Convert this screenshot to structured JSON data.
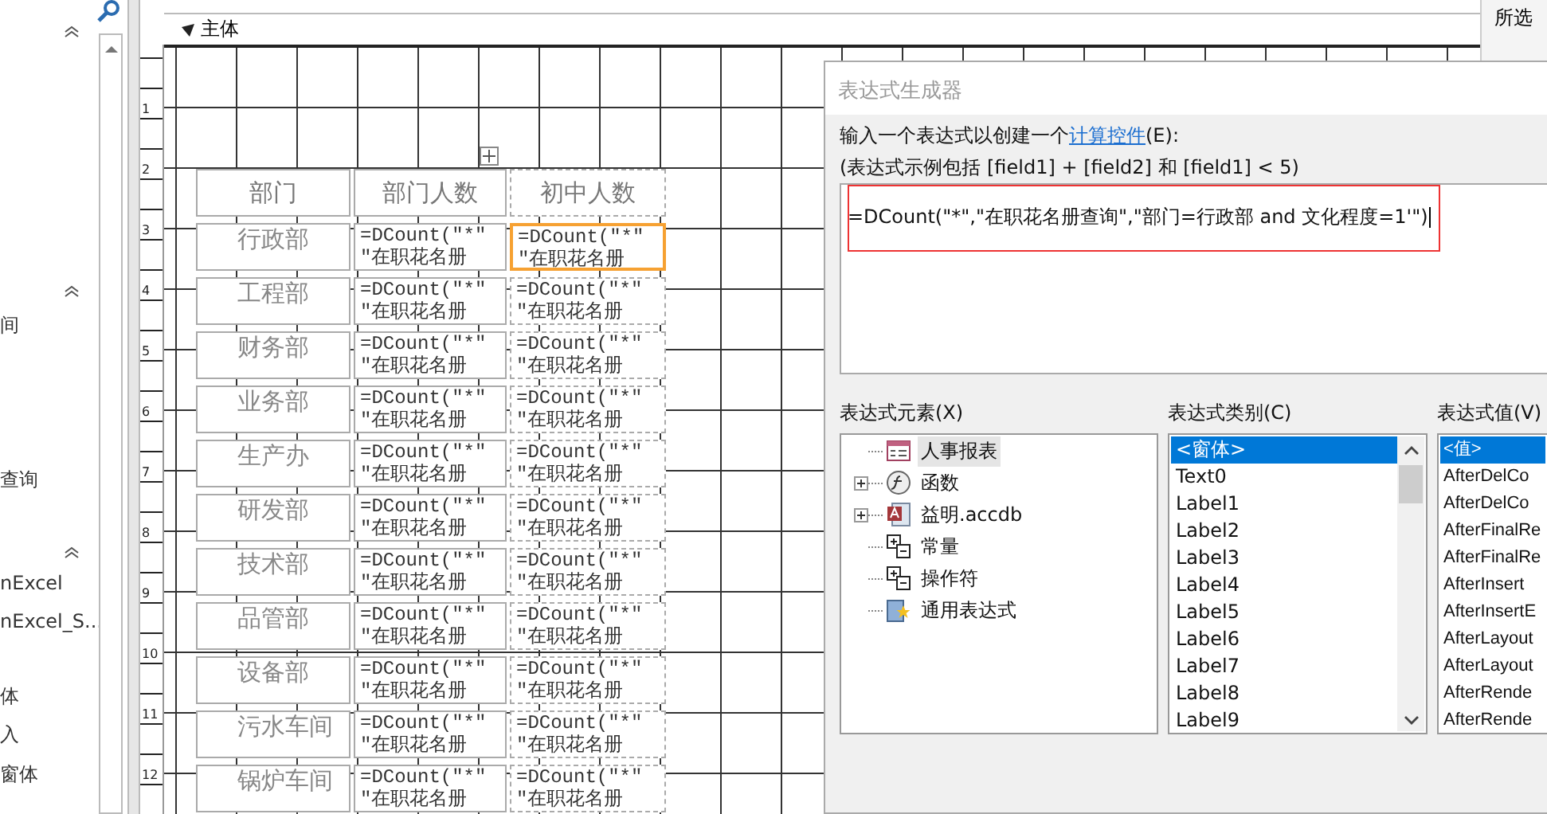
{
  "nav_pane": {
    "items": [
      "间",
      "查询",
      "nExcel",
      "nExcel_S...",
      "体",
      "入",
      "窗体"
    ]
  },
  "side_panel": {
    "text": "所选"
  },
  "designer": {
    "section": "主体",
    "ruler": [
      "1",
      "2",
      "3",
      "4",
      "5",
      "6",
      "7",
      "8",
      "9",
      "10",
      "11",
      "12"
    ],
    "headers": [
      "部门",
      "部门人数",
      "初中人数"
    ],
    "rows": [
      {
        "dept": "行政部",
        "count": [
          "=DCount(″*″",
          "″在职花名册"
        ],
        "junior": [
          "=DCount(″*″",
          "″在职花名册"
        ],
        "selected": true
      },
      {
        "dept": "工程部",
        "count": [
          "=DCount(″*″",
          "″在职花名册"
        ],
        "junior": [
          "=DCount(″*″",
          "″在职花名册"
        ],
        "selected": false
      },
      {
        "dept": "财务部",
        "count": [
          "=DCount(″*″",
          "″在职花名册"
        ],
        "junior": [
          "=DCount(″*″",
          "″在职花名册"
        ],
        "selected": false
      },
      {
        "dept": "业务部",
        "count": [
          "=DCount(″*″",
          "″在职花名册"
        ],
        "junior": [
          "=DCount(″*″",
          "″在职花名册"
        ],
        "selected": false
      },
      {
        "dept": "生产办",
        "count": [
          "=DCount(″*″",
          "″在职花名册"
        ],
        "junior": [
          "=DCount(″*″",
          "″在职花名册"
        ],
        "selected": false
      },
      {
        "dept": "研发部",
        "count": [
          "=DCount(″*″",
          "″在职花名册"
        ],
        "junior": [
          "=DCount(″*″",
          "″在职花名册"
        ],
        "selected": false
      },
      {
        "dept": "技术部",
        "count": [
          "=DCount(″*″",
          "″在职花名册"
        ],
        "junior": [
          "=DCount(″*″",
          "″在职花名册"
        ],
        "selected": false
      },
      {
        "dept": "品管部",
        "count": [
          "=DCount(″*″",
          "″在职花名册"
        ],
        "junior": [
          "=DCount(″*″",
          "″在职花名册"
        ],
        "selected": false
      },
      {
        "dept": "设备部",
        "count": [
          "=DCount(″*″",
          "″在职花名册"
        ],
        "junior": [
          "=DCount(″*″",
          "″在职花名册"
        ],
        "selected": false
      },
      {
        "dept": "污水车间",
        "count": [
          "=DCount(″*″",
          "″在职花名册"
        ],
        "junior": [
          "=DCount(″*″",
          "″在职花名册"
        ],
        "selected": false
      },
      {
        "dept": "锅炉车间",
        "count": [
          "=DCount(″*″",
          "″在职花名册"
        ],
        "junior": [
          "=DCount(″*″",
          "″在职花名册"
        ],
        "selected": false
      }
    ]
  },
  "dialog": {
    "title": "表达式生成器",
    "instruction": "输入一个表达式以创建一个",
    "instruction_link": "计算控件",
    "instruction_suffix": "(E):",
    "example": "(表达式示例包括 [field1] + [field2] 和 [field1] < 5)",
    "expression": "=DCount(\"*\",\"在职花名册查询\",\"部门=行政部 and 文化程度=1'\")",
    "elements_label": "表达式元素(X)",
    "categories_label": "表达式类别(C)",
    "values_label": "表达式值(V)",
    "elements": [
      {
        "kind": "report",
        "label": "人事报表",
        "expandable": false,
        "selected": true
      },
      {
        "kind": "function",
        "label": "函数",
        "expandable": true,
        "selected": false
      },
      {
        "kind": "database",
        "label": "益明.accdb",
        "expandable": true,
        "selected": false
      },
      {
        "kind": "constant",
        "label": "常量",
        "expandable": false,
        "selected": false
      },
      {
        "kind": "operator",
        "label": "操作符",
        "expandable": false,
        "selected": false
      },
      {
        "kind": "common",
        "label": "通用表达式",
        "expandable": false,
        "selected": false
      }
    ],
    "categories": [
      {
        "label": "<窗体>",
        "selected": true
      },
      {
        "label": "Text0",
        "selected": false
      },
      {
        "label": "Label1",
        "selected": false
      },
      {
        "label": "Label2",
        "selected": false
      },
      {
        "label": "Label3",
        "selected": false
      },
      {
        "label": "Label4",
        "selected": false
      },
      {
        "label": "Label5",
        "selected": false
      },
      {
        "label": "Label6",
        "selected": false
      },
      {
        "label": "Label7",
        "selected": false
      },
      {
        "label": "Label8",
        "selected": false
      },
      {
        "label": "Label9",
        "selected": false
      }
    ],
    "values": [
      {
        "label": "<值>",
        "selected": true
      },
      {
        "label": "AfterDelCo",
        "selected": false
      },
      {
        "label": "AfterDelCo",
        "selected": false
      },
      {
        "label": "AfterFinalRe",
        "selected": false
      },
      {
        "label": "AfterFinalRe",
        "selected": false
      },
      {
        "label": "AfterInsert",
        "selected": false
      },
      {
        "label": "AfterInsertE",
        "selected": false
      },
      {
        "label": "AfterLayout",
        "selected": false
      },
      {
        "label": "AfterLayout",
        "selected": false
      },
      {
        "label": "AfterRende",
        "selected": false
      },
      {
        "label": "AfterRende",
        "selected": false
      }
    ]
  }
}
